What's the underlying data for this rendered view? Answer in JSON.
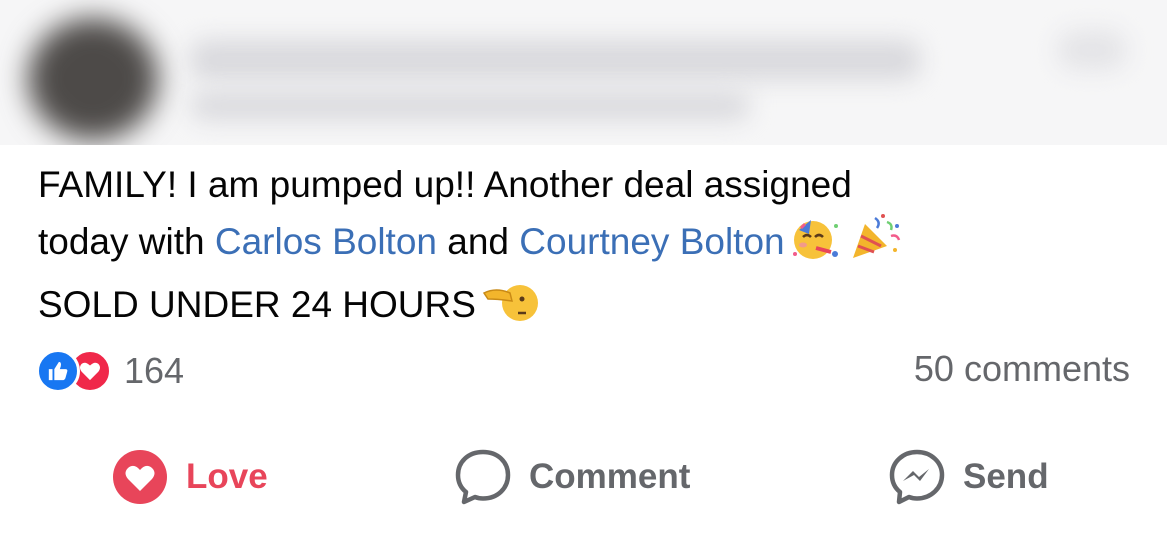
{
  "post": {
    "text_line1": "FAMILY! I am pumped up!! Another deal assigned",
    "text_line2_prefix": "today with ",
    "tag1": "Carlos Bolton",
    "text_and": " and ",
    "tag2": "Courtney Bolton",
    "text_line3": "SOLD UNDER 24 HOURS",
    "emoji_line2": [
      "partying-face-emoji",
      "party-popper-emoji"
    ],
    "emoji_line3": "pointing-face-emoji"
  },
  "reactions": {
    "icons": [
      "like-icon",
      "love-icon"
    ],
    "count": "164"
  },
  "comments": {
    "label": "50 comments"
  },
  "actions": {
    "love_label": "Love",
    "comment_label": "Comment",
    "send_label": "Send"
  },
  "colors": {
    "tag": "#3b6fb6",
    "love": "#e8455a",
    "like": "#1877f2",
    "secondary_text": "#65676b"
  }
}
